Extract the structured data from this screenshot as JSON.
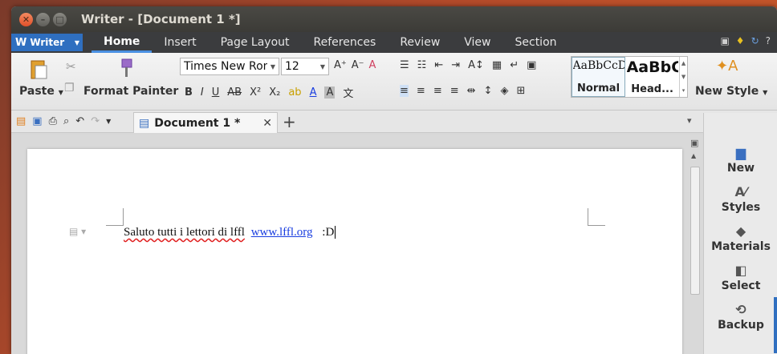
{
  "window": {
    "title": "Writer - [Document 1 *]"
  },
  "app_button": {
    "label": "Writer"
  },
  "menu_tabs": [
    "Home",
    "Insert",
    "Page Layout",
    "References",
    "Review",
    "View",
    "Section"
  ],
  "ribbon": {
    "paste_label": "Paste",
    "format_painter_label": "Format Painter",
    "font_name": "Times New Roman",
    "font_size": "12",
    "styles": [
      {
        "preview": "AaBbCcDd",
        "name": "Normal"
      },
      {
        "preview": "AaBbC",
        "name": "Head..."
      }
    ],
    "new_style_label": "New Style"
  },
  "document_tab": {
    "label": "Document 1 *"
  },
  "document": {
    "text_before": "Saluto tutti i lettori di lffl",
    "link": "www.lffl.org",
    "text_after": ":D"
  },
  "side_panel": {
    "items": [
      {
        "label": "New",
        "icon": "new-doc-icon"
      },
      {
        "label": "Styles",
        "icon": "styles-icon"
      },
      {
        "label": "Materials",
        "icon": "materials-icon"
      },
      {
        "label": "Select",
        "icon": "select-icon"
      },
      {
        "label": "Backup",
        "icon": "backup-icon"
      }
    ]
  },
  "colors": {
    "accent": "#2f6fc0",
    "link": "#1a3ee0",
    "spell_error": "#e02020"
  }
}
